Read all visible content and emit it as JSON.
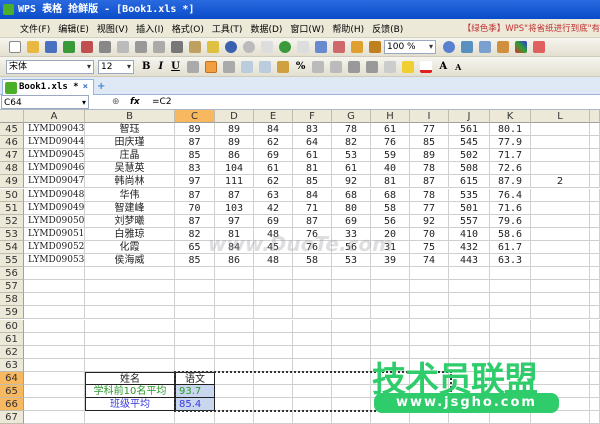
{
  "window": {
    "title": "WPS 表格 抢鲜版 - [Book1.xls *]"
  },
  "menu": {
    "items": [
      "文件(F)",
      "编辑(E)",
      "视图(V)",
      "插入(I)",
      "格式(O)",
      "工具(T)",
      "数据(D)",
      "窗口(W)",
      "帮助(H)",
      "反馈(B)"
    ],
    "promo": "【绿色季】WPS\"将省纸进行到底\"有"
  },
  "toolbar": {
    "zoom": "100 %",
    "font": "宋体",
    "font_size": "12",
    "bold": "B",
    "italic": "I",
    "underline": "U",
    "percent": "%",
    "grow_font": "A",
    "shrink_font": "A"
  },
  "tabs": [
    {
      "label": "Book1.xls *",
      "close": "×"
    }
  ],
  "tab_add": "+",
  "formula_bar": {
    "cell_ref": "C64",
    "fx": "fx",
    "formula": "=C2"
  },
  "columns": [
    "A",
    "B",
    "C",
    "D",
    "E",
    "F",
    "G",
    "H",
    "I",
    "J",
    "K",
    "L"
  ],
  "active_column": "C",
  "rows": [
    {
      "n": "45",
      "cells": [
        "LYMD09043",
        "智珏",
        "89",
        "89",
        "84",
        "83",
        "78",
        "61",
        "77",
        "561",
        "80.1",
        ""
      ]
    },
    {
      "n": "46",
      "cells": [
        "LYMD09044",
        "田庆瑾",
        "87",
        "89",
        "62",
        "64",
        "82",
        "76",
        "85",
        "545",
        "77.9",
        ""
      ]
    },
    {
      "n": "47",
      "cells": [
        "LYMD09045",
        "庄晶",
        "85",
        "86",
        "69",
        "61",
        "53",
        "59",
        "89",
        "502",
        "71.7",
        ""
      ]
    },
    {
      "n": "48",
      "cells": [
        "LYMD09046",
        "吴慧英",
        "83",
        "104",
        "61",
        "81",
        "61",
        "40",
        "78",
        "508",
        "72.6",
        ""
      ]
    },
    {
      "n": "49",
      "cells": [
        "LYMD09047",
        "韩尚林",
        "97",
        "111",
        "62",
        "85",
        "92",
        "81",
        "87",
        "615",
        "87.9",
        "2"
      ]
    },
    {
      "n": "50",
      "cells": [
        "LYMD09048",
        "华伟",
        "87",
        "87",
        "63",
        "84",
        "68",
        "68",
        "78",
        "535",
        "76.4",
        ""
      ]
    },
    {
      "n": "51",
      "cells": [
        "LYMD09049",
        "智建峰",
        "70",
        "103",
        "42",
        "71",
        "80",
        "58",
        "77",
        "501",
        "71.6",
        ""
      ]
    },
    {
      "n": "52",
      "cells": [
        "LYMD09050",
        "刘梦曦",
        "87",
        "97",
        "69",
        "87",
        "69",
        "56",
        "92",
        "557",
        "79.6",
        ""
      ]
    },
    {
      "n": "53",
      "cells": [
        "LYMD09051",
        "白雅琼",
        "82",
        "81",
        "48",
        "76",
        "33",
        "20",
        "70",
        "410",
        "58.6",
        ""
      ]
    },
    {
      "n": "54",
      "cells": [
        "LYMD09052",
        "化霞",
        "65",
        "84",
        "45",
        "76",
        "56",
        "31",
        "75",
        "432",
        "61.7",
        ""
      ]
    },
    {
      "n": "55",
      "cells": [
        "LYMD09053",
        "侯海威",
        "85",
        "86",
        "48",
        "58",
        "53",
        "39",
        "74",
        "443",
        "63.3",
        ""
      ]
    },
    {
      "n": "56",
      "cells": []
    },
    {
      "n": "57",
      "cells": []
    },
    {
      "n": "58",
      "cells": []
    },
    {
      "n": "59",
      "cells": []
    },
    {
      "n": "60",
      "cells": []
    },
    {
      "n": "61",
      "cells": []
    },
    {
      "n": "62",
      "cells": []
    },
    {
      "n": "63",
      "cells": []
    },
    {
      "n": "64",
      "cells": [
        "",
        "姓名",
        "语文"
      ]
    },
    {
      "n": "65",
      "cells": [
        "",
        "学科前10名平均",
        "93.7"
      ]
    },
    {
      "n": "66",
      "cells": [
        "",
        "班级平均",
        "85.4"
      ]
    },
    {
      "n": "67",
      "cells": []
    }
  ],
  "summary_colors": {
    "top10": "#2a9a2a",
    "class": "#3a3ae0",
    "selection": "#c8d6ee"
  },
  "watermark": {
    "site_overlay": "www.DuoTe.com",
    "logo_text": "技术员联盟",
    "logo_url": "www.jsgho.com"
  }
}
